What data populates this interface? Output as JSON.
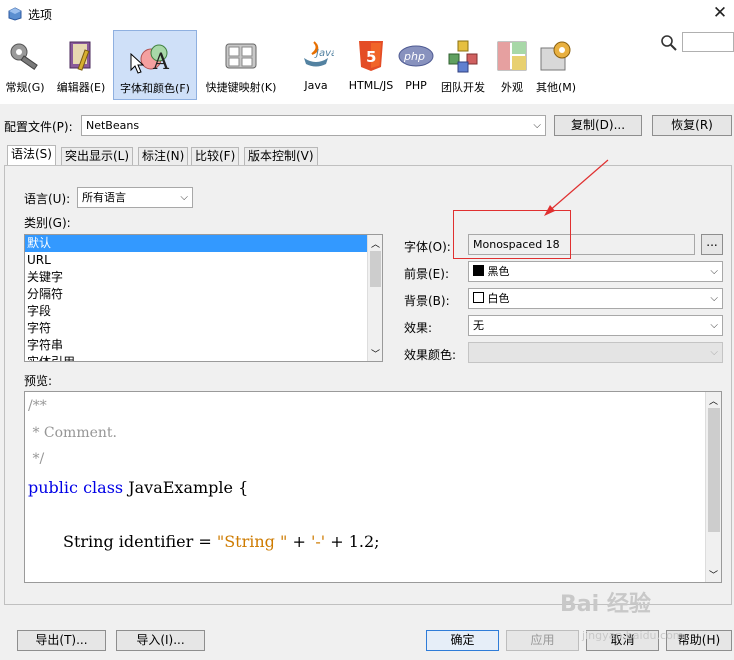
{
  "window": {
    "title": "选项",
    "close": "✕"
  },
  "categories": [
    {
      "label": "常规(G)",
      "icon": "wrench-gear-icon"
    },
    {
      "label": "编辑器(E)",
      "icon": "editor-book-icon"
    },
    {
      "label": "字体和颜色(F)",
      "icon": "font-color-icon",
      "selected": true
    },
    {
      "label": "快捷键映射(K)",
      "icon": "keyboard-icon"
    },
    {
      "label": "Java",
      "icon": "java-icon"
    },
    {
      "label": "HTML/JS",
      "icon": "html5-icon"
    },
    {
      "label": "PHP",
      "icon": "php-icon"
    },
    {
      "label": "团队开发",
      "icon": "team-cubes-icon"
    },
    {
      "label": "外观",
      "icon": "appearance-icon"
    },
    {
      "label": "其他(M)",
      "icon": "misc-gears-icon"
    }
  ],
  "search": {
    "value": ""
  },
  "profile": {
    "label": "配置文件(P):",
    "value": "NetBeans",
    "copy_button": "复制(D)...",
    "restore_button": "恢复(R)"
  },
  "tabs": [
    "语法(S)",
    "突出显示(L)",
    "标注(N)",
    "比较(F)",
    "版本控制(V)"
  ],
  "syntax": {
    "language_label": "语言(U):",
    "language_value": "所有语言",
    "category_label": "类别(G):",
    "category_items": [
      "默认",
      "URL",
      "关键字",
      "分隔符",
      "字段",
      "字符",
      "字符串",
      "实体引用"
    ],
    "font_label": "字体(O):",
    "font_value": "Monospaced 18",
    "font_button": "...",
    "foreground_label": "前景(E):",
    "foreground_value": "黑色",
    "foreground_color": "#000000",
    "background_label": "背景(B):",
    "background_value": "白色",
    "background_color": "#ffffff",
    "effect_label": "效果:",
    "effect_value": "无",
    "effect_color_label": "效果颜色:",
    "effect_color_value": ""
  },
  "preview": {
    "label": "预览:",
    "line1": "/**",
    "line2": " * Comment.",
    "line3": " */",
    "kw_public": "public",
    "kw_class": "class",
    "class_name": "JavaExample {",
    "type_name": "String identifier = ",
    "str1": "\"String \"",
    "plus1": " + ",
    "str2": "'-'",
    "rest": " + 1.2;"
  },
  "footer": {
    "export": "导出(T)...",
    "import": "导入(I)...",
    "ok": "确定",
    "apply": "应用",
    "cancel": "取消",
    "help": "帮助(H)"
  },
  "watermark": {
    "text": "Bai 经验",
    "url": "jingyan.baidu.com"
  },
  "colors": {
    "selection": "#3399ff",
    "keyword": "#0000e6",
    "string": "#ce7b00",
    "comment": "#969696",
    "annotation": "#e03030"
  }
}
